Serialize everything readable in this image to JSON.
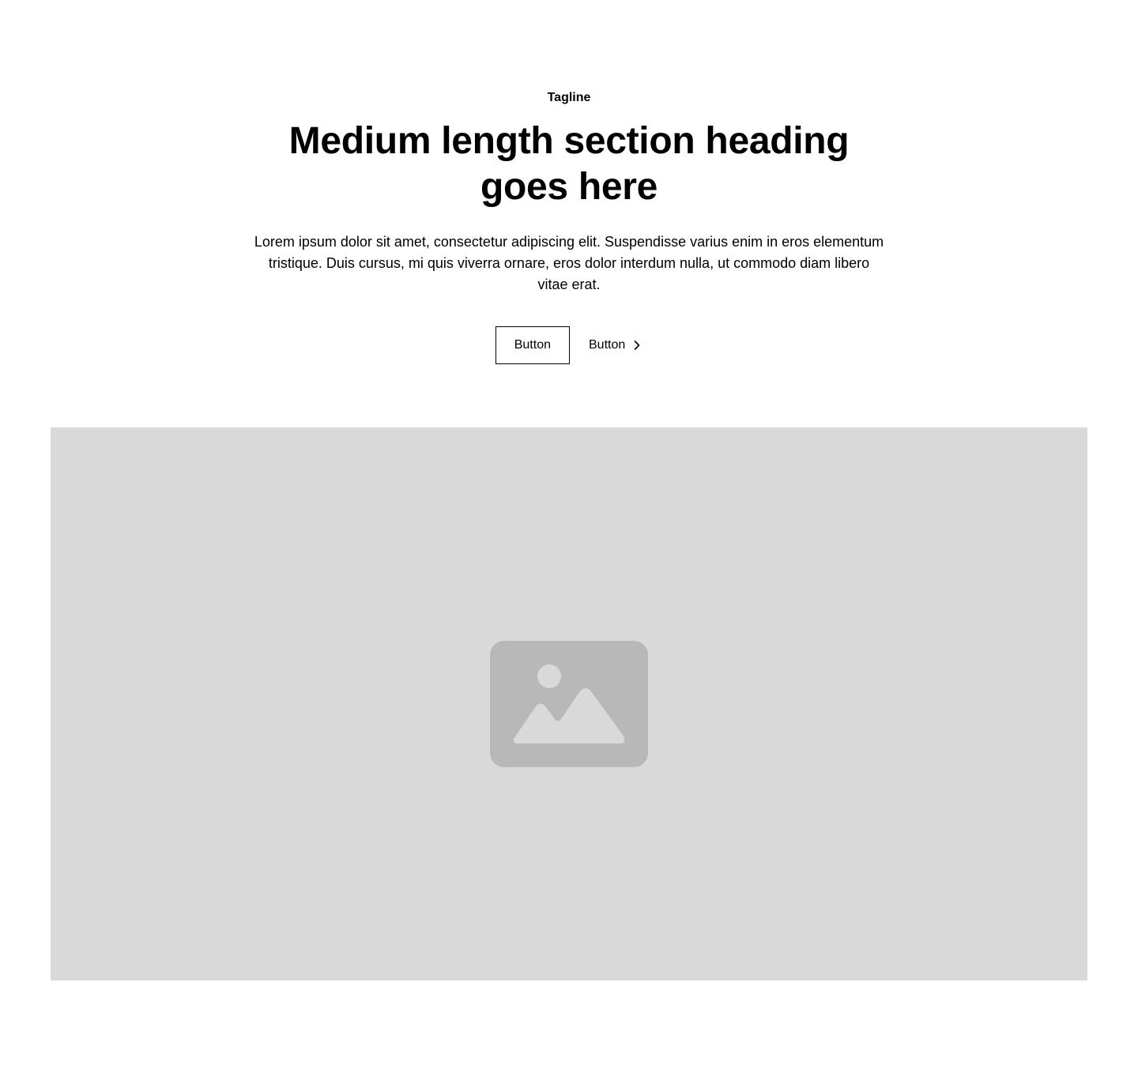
{
  "header": {
    "tagline": "Tagline",
    "heading": "Medium length section heading goes here",
    "body": "Lorem ipsum dolor sit amet, consectetur adipiscing elit. Suspendisse varius enim in eros elementum tristique. Duis cursus, mi quis viverra ornare, eros dolor interdum nulla, ut commodo diam libero vitae erat."
  },
  "actions": {
    "secondary_label": "Button",
    "link_label": "Button",
    "link_icon": "chevron-right-icon"
  },
  "media": {
    "icon": "image-placeholder-icon",
    "background_color": "#d9d9d9",
    "icon_color": "#b8b8b8"
  }
}
